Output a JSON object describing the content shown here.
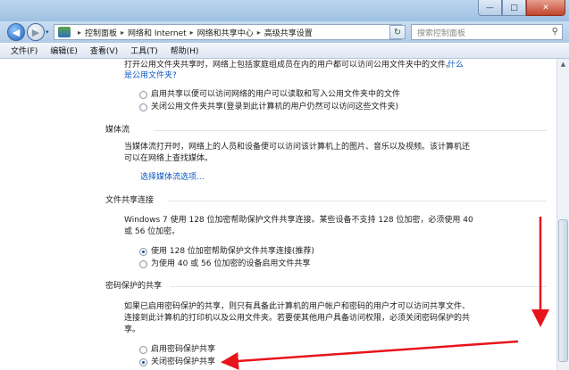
{
  "window": {
    "minimize_glyph": "—",
    "maximize_glyph": "□",
    "close_glyph": "✕"
  },
  "addressbar": {
    "crumbs": [
      "控制面板",
      "网络和 Internet",
      "网络和共享中心",
      "高级共享设置"
    ],
    "separator": "▸",
    "search_placeholder": "搜索控制面板"
  },
  "menubar": {
    "items": [
      "文件(F)",
      "编辑(E)",
      "查看(V)",
      "工具(T)",
      "帮助(H)"
    ]
  },
  "public_folder": {
    "description": "打开公用文件夹共享时，网络上包括家庭组成员在内的用户都可以访问公用文件夹中的文件。",
    "link_part1": "什么",
    "link_part2": "是公用文件夹?",
    "options": [
      {
        "label": "启用共享以便可以访问网络的用户可以读取和写入公用文件夹中的文件",
        "selected": false
      },
      {
        "label": "关闭公用文件夹共享(登录到此计算机的用户仍然可以访问这些文件夹)",
        "selected": false
      }
    ]
  },
  "media_streaming": {
    "title": "媒体流",
    "description_line1": "当媒体流打开时，网络上的人员和设备便可以访问该计算机上的图片、音乐以及视频。该计算机还",
    "description_line2": "可以在网络上查找媒体。",
    "link": "选择媒体流选项..."
  },
  "file_sharing": {
    "title": "文件共享连接",
    "description_line1": "Windows 7 使用 128 位加密帮助保护文件共享连接。某些设备不支持 128 位加密，必须使用 40",
    "description_line2": "或 56 位加密。",
    "options": [
      {
        "label": "使用 128 位加密帮助保护文件共享连接(推荐)",
        "selected": true
      },
      {
        "label": "为使用 40 或 56 位加密的设备启用文件共享",
        "selected": false
      }
    ]
  },
  "password_sharing": {
    "title": "密码保护的共享",
    "description_line1": "如果已启用密码保护的共享，则只有具备此计算机的用户帐户和密码的用户才可以访问共享文件、",
    "description_line2": "连接到此计算机的打印机以及公用文件夹。若要使其他用户具备访问权限，必须关闭密码保护的共",
    "description_line3": "享。",
    "options": [
      {
        "label": "启用密码保护共享",
        "selected": false
      },
      {
        "label": "关闭密码保护共享",
        "selected": true
      }
    ]
  },
  "colors": {
    "annotation_arrow": "#e8141c",
    "link": "#0b57c4"
  }
}
